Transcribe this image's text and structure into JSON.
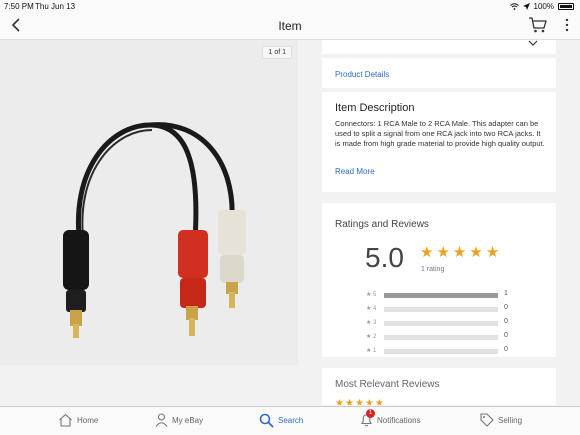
{
  "status_bar": {
    "time": "7:50 PM",
    "date": "Thu Jun 13",
    "battery": "100%"
  },
  "nav": {
    "title": "Item"
  },
  "image": {
    "counter": "1 of 1"
  },
  "product_details": {
    "label": "Product Details"
  },
  "description": {
    "title": "Item Description",
    "text": "Connectors: 1 RCA Male to 2 RCA Male. This adapter can be used to split a signal from one RCA jack into two RCA jacks. It is made from high grade material to provide high quality output.",
    "read_more": "Read More"
  },
  "ratings": {
    "title": "Ratings and Reviews",
    "average": "5.0",
    "stars": 5,
    "count_label": "1 rating",
    "breakdown": [
      {
        "label": "★ 5",
        "count": "1",
        "fraction": 1.0
      },
      {
        "label": "★ 4",
        "count": "0",
        "fraction": 0
      },
      {
        "label": "★ 3",
        "count": "0",
        "fraction": 0
      },
      {
        "label": "★ 2",
        "count": "0",
        "fraction": 0
      },
      {
        "label": "★ 1",
        "count": "0",
        "fraction": 0
      }
    ]
  },
  "reviews": {
    "title": "Most Relevant Reviews"
  },
  "tab_bar": {
    "home": "Home",
    "my_ebay": "My eBay",
    "search": "Search",
    "notifications": "Notifications",
    "notifications_badge": "1",
    "selling": "Selling"
  },
  "colors": {
    "accent": "#2f6bc6",
    "star": "#f0a020",
    "badge": "#dd2222"
  }
}
